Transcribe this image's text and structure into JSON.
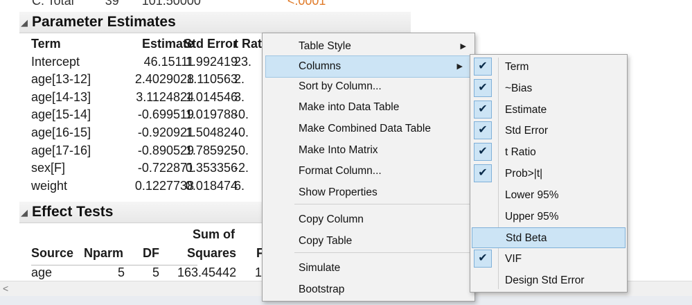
{
  "report": {
    "clipped_row": {
      "label": "C. Total",
      "df": "39",
      "ss": "101.50000",
      "p": "<.0001"
    },
    "param_title": "Parameter Estimates",
    "param_headers": [
      "Term",
      "Estimate",
      "Std Error",
      "t Rat"
    ],
    "param_rows": [
      {
        "term": "Intercept",
        "est": "46.15111",
        "se": "1.992419",
        "t": "23."
      },
      {
        "term": "age[13-12]",
        "est": "2.4029028",
        "se": "1.110563",
        "t": "2."
      },
      {
        "term": "age[14-13]",
        "est": "3.1124824",
        "se": "1.014546",
        "t": "3."
      },
      {
        "term": "age[15-14]",
        "est": "-0.699519",
        "se": "1.019788",
        "t": "-0."
      },
      {
        "term": "age[16-15]",
        "est": "-0.920921",
        "se": "1.504824",
        "t": "-0."
      },
      {
        "term": "age[17-16]",
        "est": "-0.890529",
        "se": "1.785925",
        "t": "-0."
      },
      {
        "term": "sex[F]",
        "est": "-0.722871",
        "se": "0.353356",
        "t": "-2."
      },
      {
        "term": "weight",
        "est": "0.1227738",
        "se": "0.018474",
        "t": "6."
      }
    ],
    "effect_title": "Effect Tests",
    "effect_headers": {
      "sum_of": "Sum of",
      "source": "Source",
      "nparm": "Nparm",
      "df": "DF",
      "squares": "Squares",
      "f": "F"
    },
    "effect_rows": [
      {
        "source": "age",
        "nparm": "5",
        "df": "5",
        "ss": "163.45442",
        "f": "1"
      }
    ]
  },
  "menu": {
    "items": [
      {
        "label": "Table Style",
        "submenu": true
      },
      {
        "label": "Columns",
        "submenu": true,
        "highlighted": true
      },
      {
        "label": "Sort by Column..."
      },
      {
        "label": "Make into Data Table"
      },
      {
        "label": "Make Combined Data Table"
      },
      {
        "label": "Make Into Matrix"
      },
      {
        "label": "Format Column..."
      },
      {
        "label": "Show Properties"
      },
      {
        "label": "Copy Column"
      },
      {
        "label": "Copy Table"
      },
      {
        "label": "Simulate"
      },
      {
        "label": "Bootstrap"
      }
    ]
  },
  "columns_submenu": {
    "items": [
      {
        "label": "Term",
        "checked": true
      },
      {
        "label": "~Bias",
        "checked": true
      },
      {
        "label": "Estimate",
        "checked": true
      },
      {
        "label": "Std Error",
        "checked": true
      },
      {
        "label": "t Ratio",
        "checked": true
      },
      {
        "label": "Prob>|t|",
        "checked": true
      },
      {
        "label": "Lower 95%",
        "checked": false
      },
      {
        "label": "Upper 95%",
        "checked": false
      },
      {
        "label": "Std Beta",
        "checked": false,
        "highlighted": true
      },
      {
        "label": "VIF",
        "checked": true
      },
      {
        "label": "Design Std Error",
        "checked": false
      }
    ],
    "check_glyph": "✔"
  },
  "icons": {
    "collapse": "◢",
    "submenu_arrow": "▶",
    "scroll_left": "<"
  }
}
